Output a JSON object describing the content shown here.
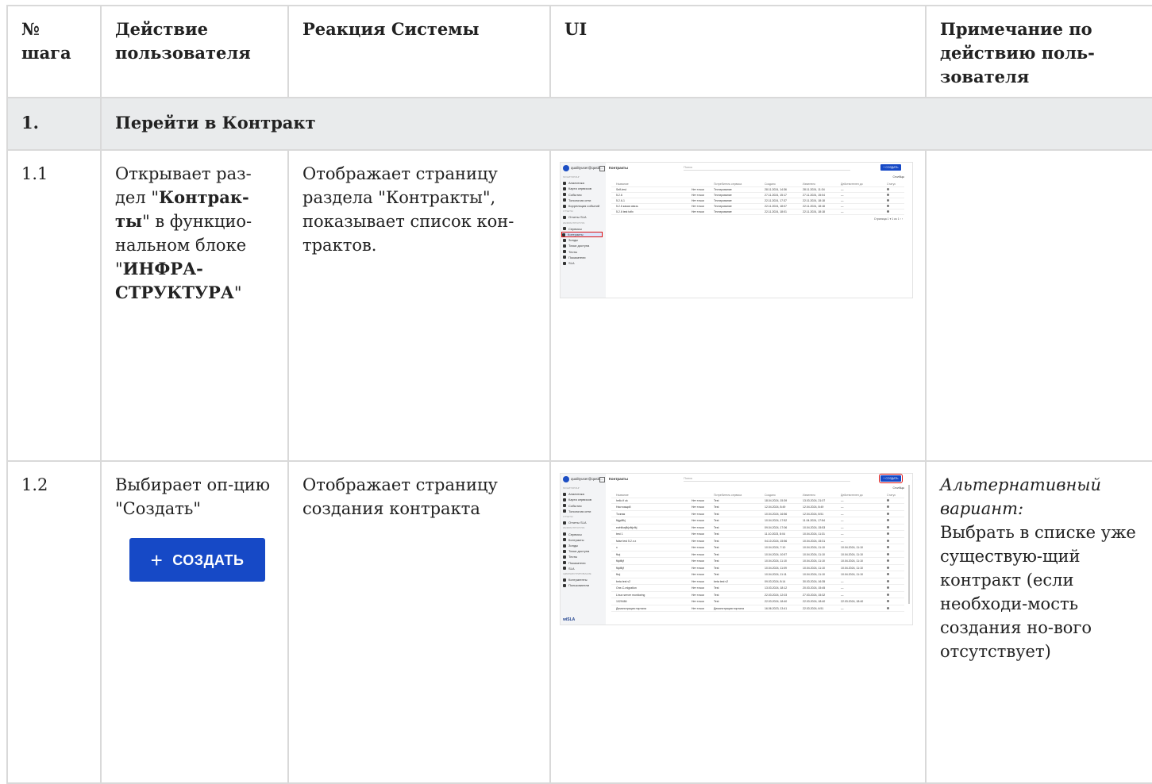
{
  "headers": {
    "step": "№ шага",
    "user_action": "Действие пользователя",
    "system_reaction": "Реакция Системы",
    "ui": "UI",
    "note": "Примечание по действию поль-зователя"
  },
  "section": {
    "num": "1.",
    "title": "Перейти в Контракт"
  },
  "row1": {
    "num": "1.1",
    "action_a": "Открывает раз-дел \"",
    "action_bold1": "Контрак-ты",
    "action_b": "\" в функцио-нальном блоке \"",
    "action_bold2": "ИНФРА-СТРУКТУРА",
    "action_c": "\"",
    "reaction": "Отображает страницу раздела \"Контракты\", показывает список кон-трактов.",
    "note": ""
  },
  "row2": {
    "num": "1.2",
    "action": "Выбирает оп-цию \"Создать\"",
    "button_plus": "+",
    "button_label": "СОЗДАТЬ",
    "reaction": "Отображает страницу создания контракта",
    "note_italic": "Альтернативный вариант:",
    "note": "Выбрать в списке уже существую-щий контракт (если необходи-мость создания но-вого отсутствует)"
  },
  "mini1": {
    "user": "qualityuser@qasb...",
    "page_title": "Контракты",
    "search": "Поиск",
    "create": "+ СОЗДАТЬ",
    "columns": "Столбцы",
    "sidebar": [
      {
        "label": "МОНИТОРИНГ",
        "grp": true
      },
      {
        "label": "Аналитика"
      },
      {
        "label": "Карта сервисов"
      },
      {
        "label": "События"
      },
      {
        "label": "Топология сети"
      },
      {
        "label": "Корреляция событий"
      },
      {
        "label": "ОТЧЕТЫ",
        "grp": true
      },
      {
        "label": "Отчеты SLA"
      },
      {
        "label": "ИНФРАСТРУКТУРА",
        "grp": true
      },
      {
        "label": "Сервисы"
      },
      {
        "label": "Контракты",
        "sel": true
      },
      {
        "label": "Зонды"
      },
      {
        "label": "Точки доступа"
      },
      {
        "label": "Тесты"
      },
      {
        "label": "Показатели"
      },
      {
        "label": "SLA"
      }
    ],
    "head": [
      "Название",
      "",
      "Потребитель сервиса",
      "Создано",
      "Изменено",
      "Действителен до",
      "Статус"
    ],
    "rows": [
      [
        "Self-test",
        "Нет точки",
        "Тестирование",
        "28.11.2024, 14:36",
        "28.11.2024, 11:34",
        "—"
      ],
      [
        "5.2.6",
        "Нет точки",
        "Тестирование",
        "27.11.2024, 15:17",
        "27.11.2024, 15:04",
        "—"
      ],
      [
        "5.2.6-1",
        "Нет точки",
        "Тестирование",
        "22.11.2024, 17:37",
        "22.11.2024, 18:18",
        "—"
      ],
      [
        "5.2.6 какая связь",
        "Нет точки",
        "Тестирование",
        "22.11.2024, 18:07",
        "22.11.2024, 18:18",
        "—"
      ],
      [
        "5.2.6 test tofix",
        "Нет точки",
        "Тестирование",
        "22.11.2024, 18:01",
        "22.11.2024, 18:18",
        "—"
      ]
    ],
    "pager": "Страница 1 ▾  1 из 1  ‹ ›"
  },
  "mini2": {
    "user": "qualityuser@qasb...",
    "page_title": "Контракты",
    "search": "Поиск",
    "create": "+ СОЗДАТЬ",
    "columns": "Столбцы",
    "brand": "wiSLA",
    "sidebar": [
      {
        "label": "МОНИТОРИНГ",
        "grp": true
      },
      {
        "label": "Аналитика"
      },
      {
        "label": "Карта сервисов"
      },
      {
        "label": "События"
      },
      {
        "label": "Топология сети"
      },
      {
        "label": "ОТЧЕТЫ",
        "grp": true
      },
      {
        "label": "Отчеты SLA"
      },
      {
        "label": "ИНФРАСТРУКТУРА",
        "grp": true
      },
      {
        "label": "Сервисы"
      },
      {
        "label": "Контракты"
      },
      {
        "label": "Зонды"
      },
      {
        "label": "Точки доступа"
      },
      {
        "label": "Тесты"
      },
      {
        "label": "Показатели"
      },
      {
        "label": "SLA"
      },
      {
        "label": "АДМИНИСТРИРОВАНИЕ",
        "grp": true
      },
      {
        "label": "Контрагенты"
      },
      {
        "label": "Пользователи"
      }
    ],
    "head": [
      "Название",
      "",
      "Потребитель сервиса",
      "Создано",
      "Изменено",
      "Действителен до",
      "Статус"
    ],
    "rows": [
      [
        "hello if ok",
        "Нет точки",
        "Test",
        "18.04.2024, 15:39",
        "13.03.2024, 21:07",
        "—"
      ],
      [
        "Настоящий",
        "Нет точки",
        "Test",
        "12.04.2024, 8:49",
        "12.04.2024, 8:49",
        "—"
      ],
      [
        "Точная",
        "Нет точки",
        "Test",
        "10.04.2024, 16:56",
        "12.04.2024, 8:51",
        "—"
      ],
      [
        "fkjgdlfkj",
        "Нет точки",
        "Test",
        "10.04.2024, 17:52",
        "11.04.2024, 17:54",
        "—"
      ],
      [
        "ewhfkwjfkjvfkjvfkj",
        "Нет точки",
        "Test",
        "09.04.2024, 17:06",
        "10.04.2024, 15:53",
        "—"
      ],
      [
        "test 1",
        "Нет точки",
        "Test",
        "11.10.2023, 8:04",
        "10.04.2024, 11:31",
        "—"
      ],
      [
        "false test 5.2.x.x",
        "Нет точки",
        "Test",
        "04.10.2024, 15:56",
        "10.04.2024, 15:31",
        "—"
      ],
      [
        "x",
        "Нет точки",
        "Test",
        "10.04.2024, 7:10",
        "10.04.2024, 11:10",
        "10.04.2024, 11:10"
      ],
      [
        "fkvj",
        "Нет точки",
        "Test",
        "10.04.2024, 10:57",
        "10.04.2024, 11:10",
        "10.04.2024, 11:10"
      ],
      [
        "fkjdfkjf",
        "Нет точки",
        "Test",
        "10.04.2024, 11:10",
        "10.04.2024, 11:10",
        "10.04.2024, 11:10"
      ],
      [
        "fkjdfkjf",
        "Нет точки",
        "Test",
        "10.04.2024, 11:09",
        "10.04.2024, 11:10",
        "10.04.2024, 11:10"
      ],
      [
        "fkvj",
        "Нет точки",
        "Test",
        "10.04.2024, 11:11",
        "10.04.2024, 11:10",
        "10.04.2024, 11:10"
      ],
      [
        "beta test v2",
        "Нет точки",
        "beta test v2",
        "09.03.2024, 8:14",
        "30.03.2024, 16:35",
        "—"
      ],
      [
        "One-C-migration",
        "Нет точки",
        "Test",
        "13.03.2024, 18:12",
        "20.03.2024, 15:45",
        "—"
      ],
      [
        "Linux server monitoring",
        "Нет точки",
        "Test",
        "22.03.2024, 12:03",
        "27.03.2024, 15:32",
        "—"
      ],
      [
        "1029484",
        "Нет точки",
        "Test",
        "22.03.2024, 18:40",
        "22.03.2024, 18:40",
        "22.03.2024, 18:40"
      ],
      [
        "Демонстрация портала",
        "Нет точки",
        "Демонстрация портала",
        "16.06.2023, 13:41",
        "22.03.2024, 6:51",
        "—"
      ]
    ]
  }
}
